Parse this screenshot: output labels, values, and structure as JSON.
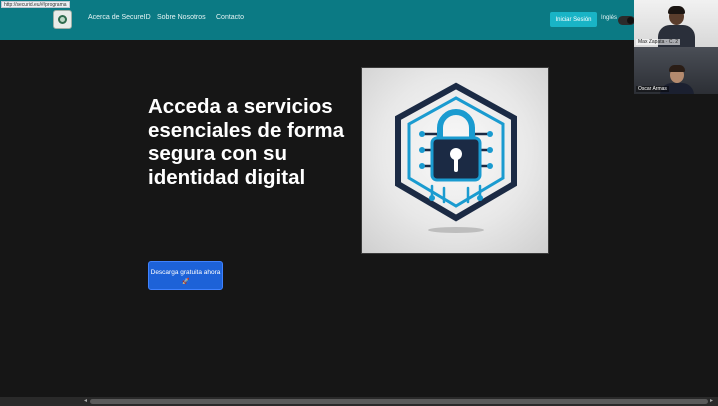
{
  "navbar": {
    "links": [
      "Acerca de SecureID",
      "Sobre Nosotros",
      "Contacto"
    ],
    "login_label": "Iniciar Sesión",
    "language_label": "Inglés",
    "background": "#0b7a84"
  },
  "video_call": {
    "participants": [
      {
        "name": "Max Zapata · C. 2"
      },
      {
        "name": "Oscar Armas"
      }
    ]
  },
  "hero": {
    "title": "Acceda a servicios esenciales de forma segura con su identidad digital",
    "cta_label": "Descarga gratuita ahora",
    "cta_icon": "🚀",
    "cta_color": "#1d62d8",
    "image_icon": "padlock-circuit-icon",
    "image_colors": {
      "blue": "#1a9bd0",
      "navy": "#1b2a44"
    }
  },
  "status_bar": {
    "url": "http://securid.eu/#/programa"
  }
}
